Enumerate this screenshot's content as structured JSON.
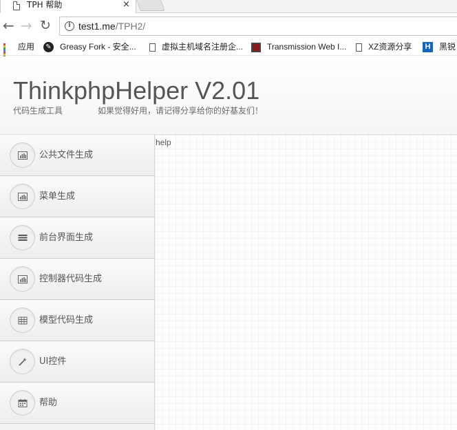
{
  "browser": {
    "tab_title": "TPH 帮助",
    "tab_close": "×",
    "url_host": "test1.me",
    "url_path": "/TPH2/",
    "bookmarks": [
      {
        "label": "应用",
        "icon": "apps-grid-icon"
      },
      {
        "label": "Greasy Fork - 安全...",
        "icon": "greasy-fork-icon"
      },
      {
        "label": "虚拟主机域名注册企...",
        "icon": "page-icon"
      },
      {
        "label": "Transmission Web I...",
        "icon": "transmission-icon"
      },
      {
        "label": "XZ资源分享",
        "icon": "page-icon"
      },
      {
        "label": "黑锐",
        "icon": "h-site-icon"
      }
    ]
  },
  "header": {
    "title": "ThinkphpHelper V2.01",
    "subtitle": "代码生成工具",
    "tagline": "如果觉得好用，请记得分享给你的好基友们！"
  },
  "sidebar": {
    "items": [
      {
        "label": "公共文件生成",
        "icon": "bar-chart-icon"
      },
      {
        "label": "菜单生成",
        "icon": "bar-chart-icon"
      },
      {
        "label": "前台界面生成",
        "icon": "list-icon"
      },
      {
        "label": "控制器代码生成",
        "icon": "bar-chart-icon"
      },
      {
        "label": "模型代码生成",
        "icon": "table-icon"
      },
      {
        "label": "UI控件",
        "icon": "magic-wand-icon"
      },
      {
        "label": "帮助",
        "icon": "calendar-icon"
      }
    ]
  },
  "content": {
    "label": "help"
  }
}
